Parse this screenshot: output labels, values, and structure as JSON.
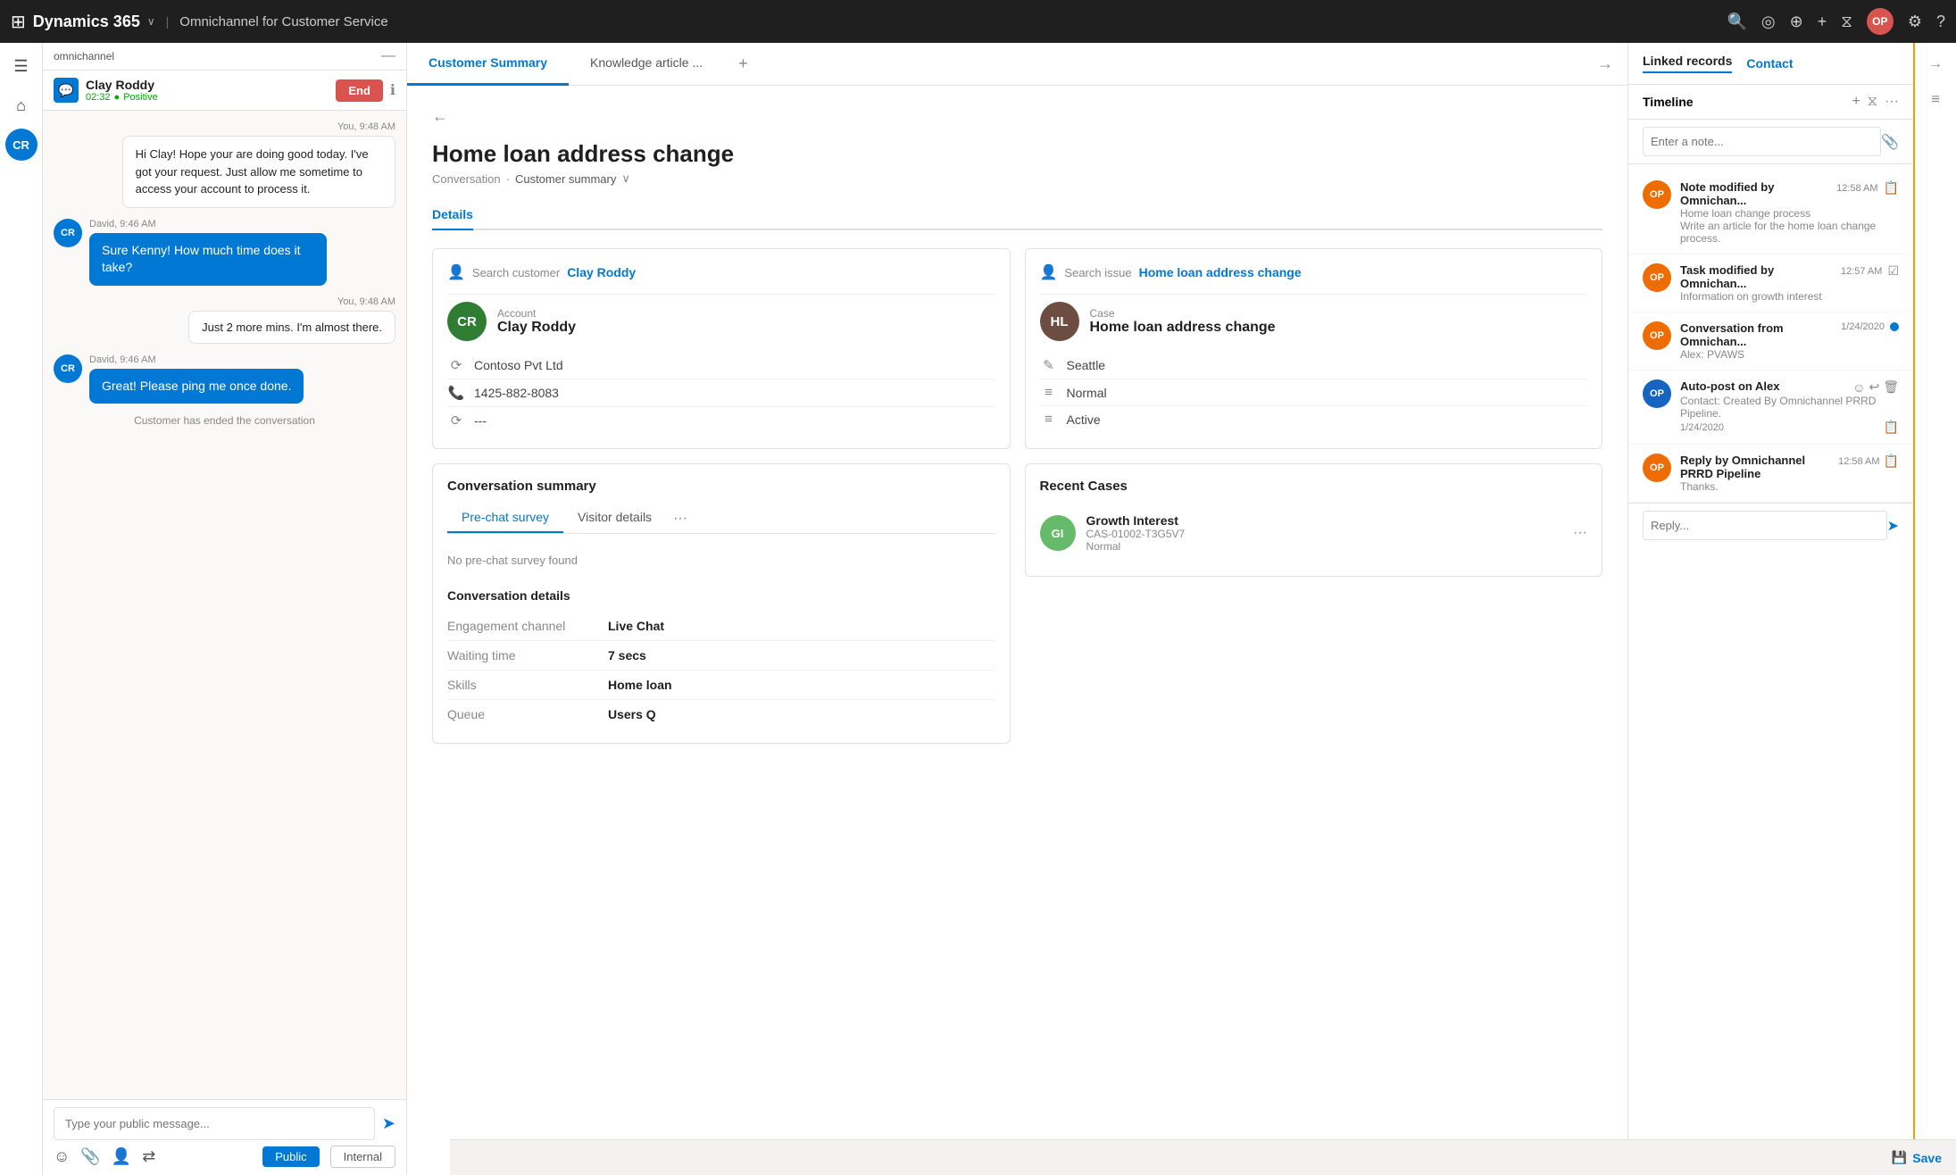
{
  "app": {
    "name": "Dynamics 365",
    "chevron": "∨",
    "module": "Omnichannel for Customer Service"
  },
  "topnav": {
    "search_icon": "🔍",
    "icons": [
      "🔍",
      "⚙",
      "?"
    ],
    "avatar_initials": "OP"
  },
  "sidebar": {
    "omnichannel_label": "omnichannel",
    "minimize": "—",
    "cr_badge": "CR",
    "home_icon": "⌂",
    "chat_icon": "💬"
  },
  "session": {
    "name": "Clay Roddy",
    "time": "02:32",
    "sentiment": "Positive",
    "end_btn": "End"
  },
  "messages": [
    {
      "sender": "You",
      "time": "9:48 AM",
      "text": "Hi Clay! Hope your are doing good today. I've got your request. Just allow me sometime to access your account to process it.",
      "type": "you"
    },
    {
      "sender": "David",
      "time": "9:46 AM",
      "text": "Sure Kenny! How much time does it take?",
      "type": "other"
    },
    {
      "sender": "You",
      "time": "9:48 AM",
      "text": "Just 2 more mins. I'm almost there.",
      "type": "you"
    },
    {
      "sender": "David",
      "time": "9:46 AM",
      "text": "Great! Please ping me once done.",
      "type": "other"
    },
    {
      "sender": "system",
      "text": "Customer has ended the conversation",
      "type": "system"
    }
  ],
  "chat_input": {
    "placeholder": "Type your public message...",
    "public_btn": "Public",
    "internal_btn": "Internal"
  },
  "tabs": {
    "customer_summary": "Customer Summary",
    "knowledge_article": "Knowledge article ...",
    "add": "+"
  },
  "page": {
    "back": "←",
    "title": "Home loan address change",
    "breadcrumb_1": "Conversation",
    "breadcrumb_sep": "·",
    "breadcrumb_2": "Customer summary",
    "tab_details": "Details"
  },
  "customer_card": {
    "search_label": "Search customer",
    "search_value": "Clay Roddy",
    "account_label": "Account",
    "name": "Clay Roddy",
    "company": "Contoso Pvt Ltd",
    "phone": "1425-882-8083",
    "extra": "---",
    "avatar_initials": "CR"
  },
  "case_card": {
    "search_label": "Search issue",
    "search_value": "Home loan address change",
    "case_label": "Case",
    "case_name": "Home loan address change",
    "location": "Seattle",
    "priority": "Normal",
    "status": "Active",
    "avatar_initials": "HL"
  },
  "conversation_summary": {
    "title": "Conversation summary",
    "tab_prechat": "Pre-chat survey",
    "tab_visitor": "Visitor details",
    "no_survey": "No pre-chat survey found",
    "details_title": "Conversation details",
    "fields": [
      {
        "label": "Engagement channel",
        "value": "Live Chat"
      },
      {
        "label": "Waiting time",
        "value": "7 secs"
      },
      {
        "label": "Skills",
        "value": "Home loan"
      },
      {
        "label": "Queue",
        "value": "Users Q"
      }
    ]
  },
  "recent_cases": {
    "title": "Recent Cases",
    "items": [
      {
        "avatar": "GI",
        "name": "Growth Interest",
        "id": "CAS-01002-T3G5V7",
        "status": "Normal"
      }
    ]
  },
  "right_panel": {
    "linked_records": "Linked records",
    "contact": "Contact",
    "timeline_label": "Timeline",
    "note_placeholder": "Enter a note...",
    "timeline_items": [
      {
        "avatar": "OP",
        "title": "Note modified by Omnichan...",
        "subtitle": "Home loan change process",
        "detail": "Write an article for the home loan change process.",
        "time": "12:58 AM",
        "icon": "📋"
      },
      {
        "avatar": "OP",
        "title": "Task modified by Omnichan...",
        "subtitle": "Information on growth interest",
        "detail": "",
        "time": "12:57 AM",
        "icon": "☑"
      },
      {
        "avatar": "OP",
        "title": "Conversation from Omnichan...",
        "subtitle": "Alex: PVAWS",
        "detail": "",
        "time": "1/24/2020",
        "icon": ""
      },
      {
        "avatar": "OP",
        "title": "Auto-post on Alex",
        "subtitle": "Contact: Created By Omnichannel PRRD Pipeline.",
        "detail": "",
        "time": "1/24/2020",
        "icon": ""
      },
      {
        "avatar": "OP",
        "title": "Reply by Omnichannel PRRD Pipeline",
        "subtitle": "Thanks.",
        "detail": "",
        "time": "12:58 AM",
        "icon": ""
      }
    ],
    "reply_placeholder": "Reply..."
  },
  "bottom": {
    "save_label": "Save"
  }
}
